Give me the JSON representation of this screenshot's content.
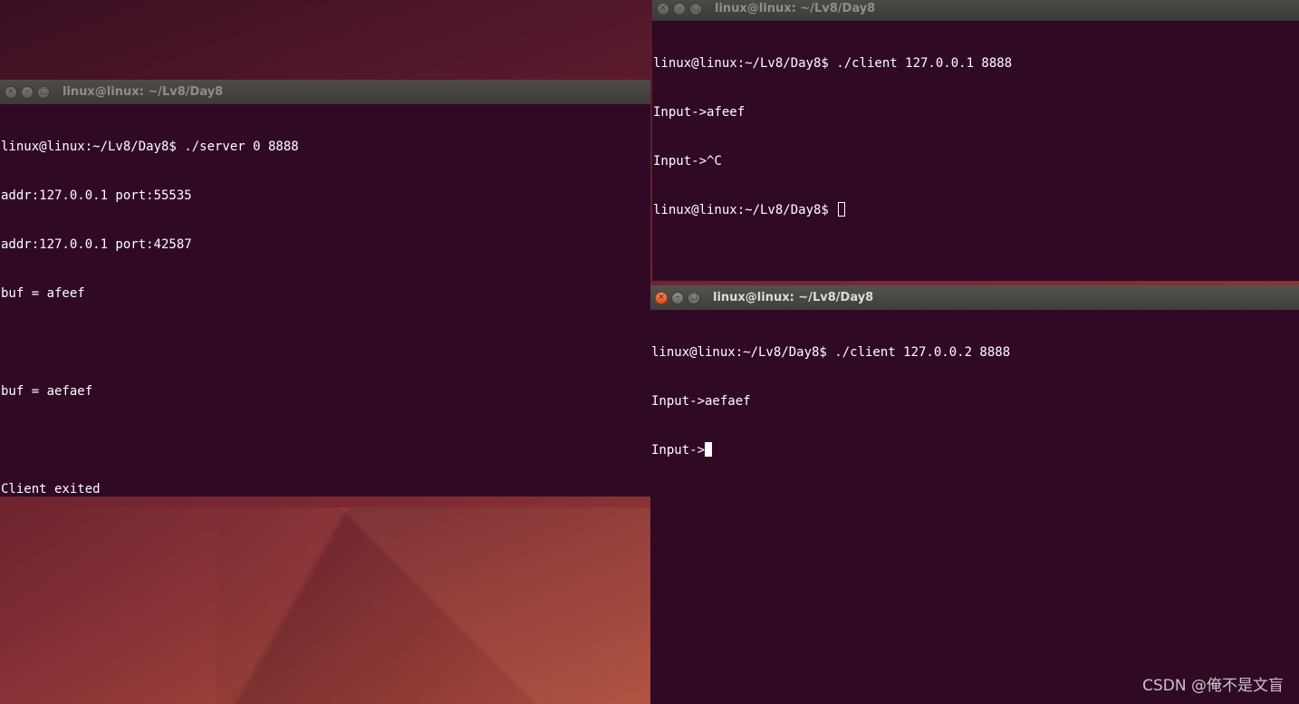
{
  "server_window": {
    "title": "linux@linux: ~/Lv8/Day8",
    "lines": [
      "linux@linux:~/Lv8/Day8$ ./server 0 8888",
      "addr:127.0.0.1 port:55535",
      "addr:127.0.0.1 port:42587",
      "buf = afeef",
      "",
      "buf = aefaef",
      "",
      "Client exited"
    ]
  },
  "client1_window": {
    "title": "linux@linux: ~/Lv8/Day8",
    "lines": [
      "linux@linux:~/Lv8/Day8$ ./client 127.0.0.1 8888",
      "Input->afeef",
      "Input->^C"
    ],
    "prompt": "linux@linux:~/Lv8/Day8$ "
  },
  "client2_window": {
    "title": "linux@linux: ~/Lv8/Day8",
    "lines": [
      "linux@linux:~/Lv8/Day8$ ./client 127.0.0.2 8888",
      "Input->aefaef"
    ],
    "prompt": "Input->"
  },
  "window_buttons": {
    "close": "×",
    "minimize": "–",
    "maximize": "□"
  },
  "watermark": "CSDN @俺不是文盲",
  "colors": {
    "terminal_bg": "#300a24",
    "terminal_fg": "#ffffff",
    "titlebar": "#3c3b37",
    "close_active": "#df4a16"
  }
}
